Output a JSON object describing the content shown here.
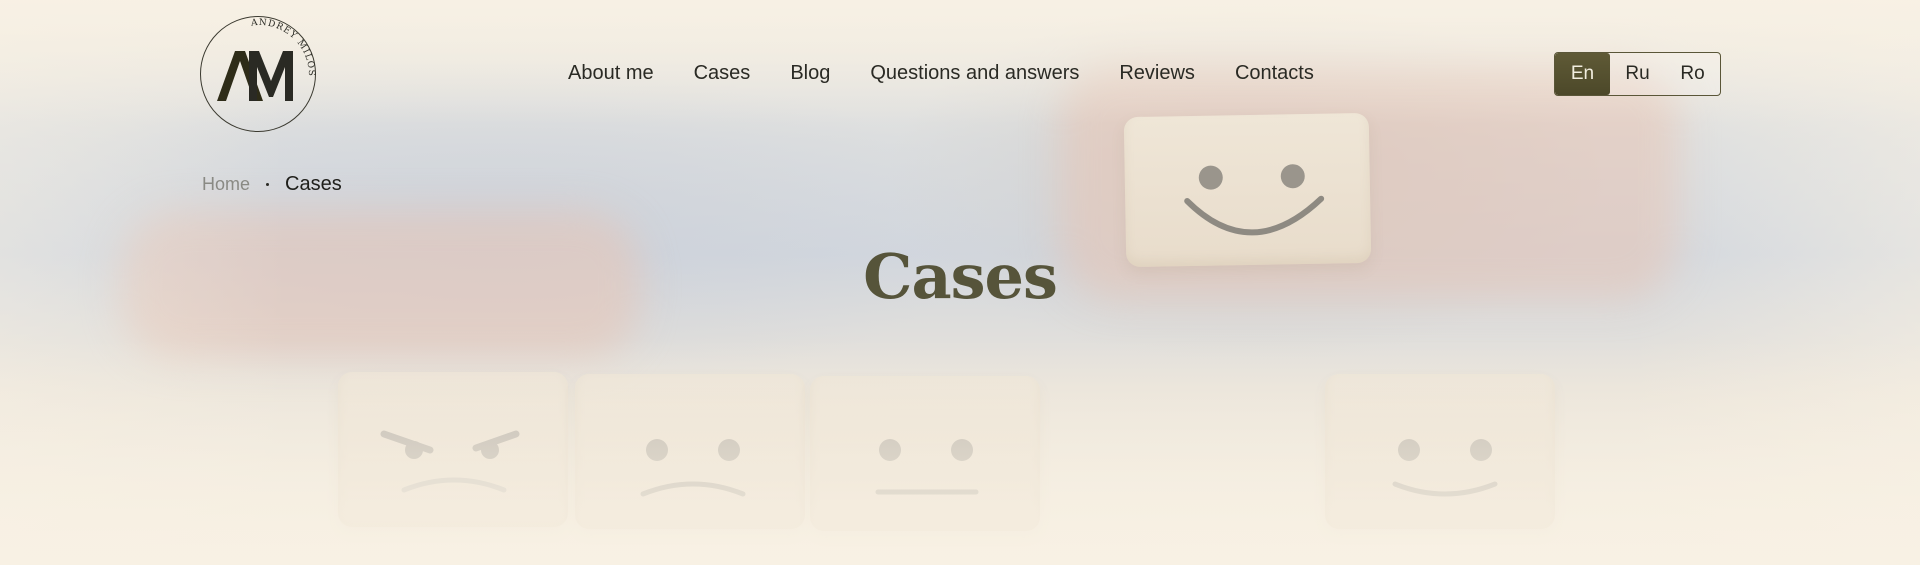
{
  "header": {
    "logo": {
      "monogram": "AM",
      "circular_text": "ANDREY MILOSTIA"
    },
    "nav": [
      {
        "label": "About me"
      },
      {
        "label": "Cases"
      },
      {
        "label": "Blog"
      },
      {
        "label": "Questions and answers"
      },
      {
        "label": "Reviews"
      },
      {
        "label": "Contacts"
      }
    ],
    "languages": [
      {
        "label": "En",
        "active": true
      },
      {
        "label": "Ru",
        "active": false
      },
      {
        "label": "Ro",
        "active": false
      }
    ]
  },
  "breadcrumb": {
    "home": "Home",
    "current": "Cases"
  },
  "page": {
    "title": "Cases"
  },
  "hero_image": {
    "faces": [
      "angry-face",
      "sad-face",
      "neutral-face",
      "happy-face",
      "happy-face"
    ]
  },
  "colors": {
    "accent": "#56543a",
    "active_lang_bg": "#5a5533",
    "background": "#f6efe2"
  }
}
